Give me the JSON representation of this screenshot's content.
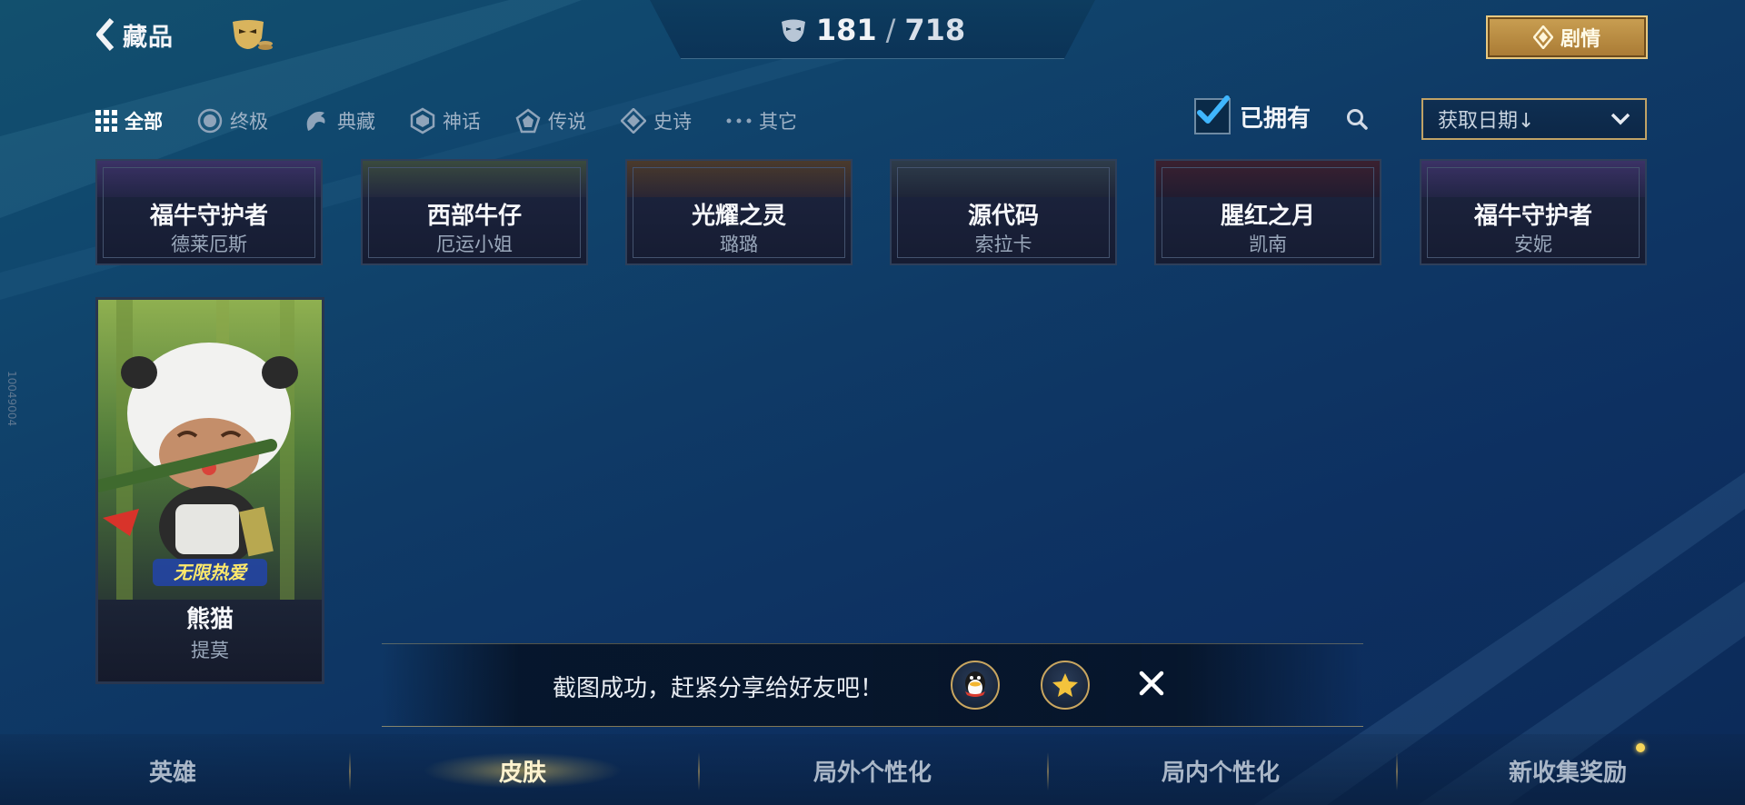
{
  "header": {
    "back_label": "藏品",
    "counter_owned": "181",
    "counter_sep": "/",
    "counter_total": "718",
    "story_label": "剧情"
  },
  "filters": [
    {
      "label": "全部",
      "icon": "grid-icon",
      "active": true
    },
    {
      "label": "终极",
      "icon": "circle-badge-icon",
      "active": false
    },
    {
      "label": "典藏",
      "icon": "dragon-icon",
      "active": false
    },
    {
      "label": "神话",
      "icon": "hexagon-icon",
      "active": false
    },
    {
      "label": "传说",
      "icon": "pentagon-icon",
      "active": false
    },
    {
      "label": "史诗",
      "icon": "diamond-icon",
      "active": false
    },
    {
      "label": "其它",
      "icon": "more-dots-icon",
      "active": false
    }
  ],
  "owned_label": "已拥有",
  "owned_checked": true,
  "sort_label": "获取日期↓",
  "cards_row1": [
    {
      "name": "福牛守护者",
      "hero": "德莱厄斯"
    },
    {
      "name": "西部牛仔",
      "hero": "厄运小姐"
    },
    {
      "name": "光耀之灵",
      "hero": "璐璐"
    },
    {
      "name": "源代码",
      "hero": "索拉卡"
    },
    {
      "name": "腥红之月",
      "hero": "凯南"
    },
    {
      "name": "福牛守护者",
      "hero": "安妮"
    }
  ],
  "card_big": {
    "name": "熊猫",
    "hero": "提莫",
    "logo_text": "无限热爱"
  },
  "toast": {
    "message": "截图成功，赶紧分享给好友吧！"
  },
  "bottom_nav": [
    {
      "label": "英雄",
      "active": false
    },
    {
      "label": "皮肤",
      "active": true
    },
    {
      "label": "局外个性化",
      "active": false
    },
    {
      "label": "局内个性化",
      "active": false
    },
    {
      "label": "新收集奖励",
      "active": false
    }
  ],
  "side_id": "10049004",
  "colors": {
    "accent_gold": "#c99f52",
    "check_blue": "#3fb6ff"
  }
}
